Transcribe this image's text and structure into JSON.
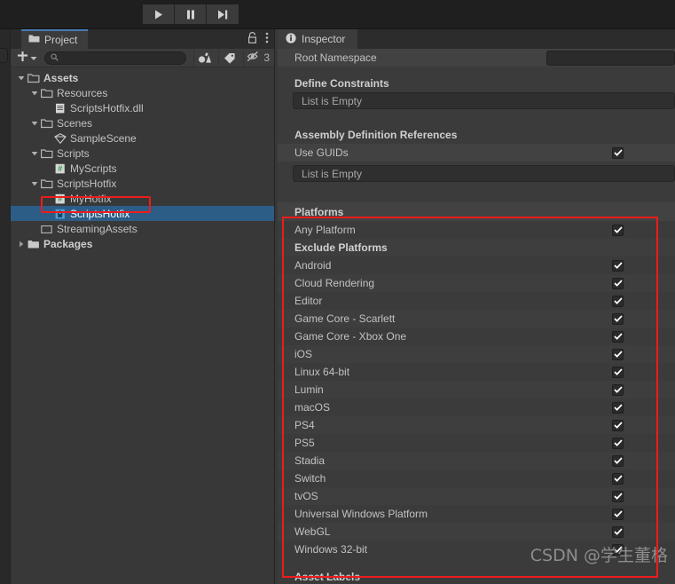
{
  "toolbar": {
    "play_label": "Play",
    "pause_label": "Pause",
    "step_label": "Step"
  },
  "project_panel": {
    "tab_label": "Project",
    "lock_label": "Lock",
    "menu_label": "Menu",
    "add_label": "Add",
    "search_placeholder": "",
    "search_value": "",
    "hidden_count": "3",
    "tree": [
      {
        "label": "Assets",
        "depth": 0,
        "twisty": "down",
        "icon": "folder-open-icon",
        "bold": true,
        "selected": false
      },
      {
        "label": "Resources",
        "depth": 1,
        "twisty": "down",
        "icon": "folder-open-icon",
        "bold": false,
        "selected": false
      },
      {
        "label": "ScriptsHotfix.dll",
        "depth": 2,
        "twisty": "none",
        "icon": "dll-file-icon",
        "bold": false,
        "selected": false
      },
      {
        "label": "Scenes",
        "depth": 1,
        "twisty": "down",
        "icon": "folder-open-icon",
        "bold": false,
        "selected": false
      },
      {
        "label": "SampleScene",
        "depth": 2,
        "twisty": "none",
        "icon": "scene-icon",
        "bold": false,
        "selected": false
      },
      {
        "label": "Scripts",
        "depth": 1,
        "twisty": "down",
        "icon": "folder-open-icon",
        "bold": false,
        "selected": false
      },
      {
        "label": "MyScripts",
        "depth": 2,
        "twisty": "none",
        "icon": "csharp-script-icon",
        "bold": false,
        "selected": false
      },
      {
        "label": "ScriptsHotfix",
        "depth": 1,
        "twisty": "down",
        "icon": "folder-open-icon",
        "bold": false,
        "selected": false
      },
      {
        "label": "MyHotfix",
        "depth": 2,
        "twisty": "none",
        "icon": "csharp-script-icon",
        "bold": false,
        "selected": false
      },
      {
        "label": "ScriptsHotfix",
        "depth": 2,
        "twisty": "none",
        "icon": "asmdef-icon",
        "bold": false,
        "selected": true
      },
      {
        "label": "StreamingAssets",
        "depth": 1,
        "twisty": "none",
        "icon": "folder-empty-icon",
        "bold": false,
        "selected": false
      },
      {
        "label": "Packages",
        "depth": 0,
        "twisty": "right",
        "icon": "folder-solid-icon",
        "bold": true,
        "selected": false
      }
    ]
  },
  "inspector": {
    "tab_label": "Inspector",
    "info_icon_label": "Info",
    "root_namespace": {
      "label": "Root Namespace",
      "value": ""
    },
    "define_constraints": {
      "title": "Define Constraints",
      "empty_text": "List is Empty"
    },
    "assembly_definition_references": {
      "title": "Assembly Definition References",
      "use_guids_label": "Use GUIDs",
      "use_guids_checked": true,
      "empty_text": "List is Empty"
    },
    "platforms": {
      "title": "Platforms",
      "any_platform_label": "Any Platform",
      "any_platform_checked": true,
      "exclude_platforms_label": "Exclude Platforms",
      "items": [
        {
          "label": "Android",
          "checked": true
        },
        {
          "label": "Cloud Rendering",
          "checked": true
        },
        {
          "label": "Editor",
          "checked": true
        },
        {
          "label": "Game Core - Scarlett",
          "checked": true
        },
        {
          "label": "Game Core - Xbox One",
          "checked": true
        },
        {
          "label": "iOS",
          "checked": true
        },
        {
          "label": "Linux 64-bit",
          "checked": true
        },
        {
          "label": "Lumin",
          "checked": true
        },
        {
          "label": "macOS",
          "checked": true
        },
        {
          "label": "PS4",
          "checked": true
        },
        {
          "label": "PS5",
          "checked": true
        },
        {
          "label": "Stadia",
          "checked": true
        },
        {
          "label": "Switch",
          "checked": true
        },
        {
          "label": "tvOS",
          "checked": true
        },
        {
          "label": "Universal Windows Platform",
          "checked": true
        },
        {
          "label": "WebGL",
          "checked": true
        },
        {
          "label": "Windows 32-bit",
          "checked": true
        }
      ]
    },
    "asset_labels_title": "Asset Labels"
  },
  "annotation": {
    "highlight_color": "#ee1c1c",
    "watermark": "CSDN @学生董格"
  }
}
